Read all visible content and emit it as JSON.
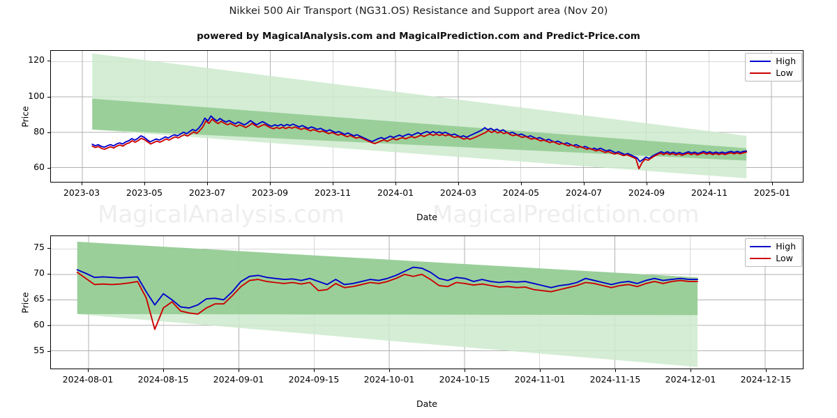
{
  "header": {
    "title": "Nikkei 500 Air Transport (NG31.OS) Resistance and Support area (Nov 20)",
    "subtitle": "powered by MagicalAnalysis.com and MagicalPrediction.com and Predict-Price.com"
  },
  "watermarks": [
    "MagicalAnalysis.com",
    "MagicalPrediction.com"
  ],
  "colors": {
    "high": "#0000cc",
    "low": "#cc0000",
    "band_outer": "#cdeacd",
    "band_inner": "#8fc98f",
    "grid": "#b0b0b0",
    "frame": "#000000"
  },
  "legend": {
    "high_label": "High",
    "low_label": "Low"
  },
  "chart_data": [
    {
      "id": "overview",
      "type": "line",
      "title": "Nikkei 500 Air Transport (NG31.OS) Resistance and Support area (Nov 20)",
      "xlabel": "Date",
      "ylabel": "Price",
      "grid": true,
      "legend_position": "top-right",
      "ylim": [
        52,
        126
      ],
      "yticks": [
        60,
        80,
        100,
        120
      ],
      "xlim": [
        "2023-03-01",
        "2025-01-01"
      ],
      "xticks": [
        "2023-03",
        "2023-05",
        "2023-07",
        "2023-09",
        "2023-11",
        "2024-01",
        "2024-03",
        "2024-05",
        "2024-07",
        "2024-09",
        "2024-11",
        "2025-01"
      ],
      "x_start_frac": 0.055,
      "x_end_frac": 0.925,
      "series": [
        {
          "name": "High",
          "color": "#0000cc",
          "values": [
            73.2,
            72.4,
            73.0,
            72.0,
            71.6,
            72.4,
            73.0,
            72.3,
            73.4,
            74.0,
            73.4,
            74.6,
            75.2,
            76.4,
            75.6,
            76.6,
            78.0,
            77.2,
            75.8,
            74.6,
            75.4,
            76.2,
            75.6,
            76.4,
            77.4,
            76.8,
            77.8,
            78.6,
            78.0,
            79.0,
            80.0,
            79.2,
            80.4,
            81.6,
            80.8,
            82.4,
            84.6,
            88.0,
            86.4,
            89.2,
            87.6,
            86.4,
            87.8,
            86.6,
            85.8,
            86.6,
            85.6,
            84.8,
            85.8,
            85.0,
            84.2,
            85.2,
            86.6,
            85.4,
            84.2,
            85.2,
            86.0,
            85.0,
            84.0,
            83.4,
            84.2,
            83.6,
            84.4,
            83.6,
            84.4,
            83.8,
            84.6,
            83.8,
            83.0,
            83.8,
            83.0,
            82.2,
            83.0,
            82.4,
            81.6,
            82.2,
            81.4,
            80.6,
            81.4,
            80.6,
            79.8,
            80.4,
            79.6,
            78.8,
            79.6,
            78.8,
            78.0,
            78.6,
            77.8,
            77.0,
            76.2,
            75.4,
            74.8,
            75.6,
            76.4,
            77.0,
            76.2,
            77.0,
            77.8,
            77.0,
            77.8,
            78.4,
            77.6,
            78.4,
            79.0,
            78.2,
            79.0,
            79.8,
            79.0,
            79.8,
            80.4,
            79.6,
            80.4,
            79.6,
            80.2,
            79.4,
            80.0,
            79.2,
            78.4,
            79.0,
            78.2,
            77.4,
            78.0,
            77.2,
            78.0,
            78.8,
            79.6,
            80.4,
            81.2,
            82.6,
            81.4,
            82.2,
            81.0,
            81.8,
            80.6,
            81.4,
            80.2,
            79.4,
            80.0,
            79.2,
            78.4,
            79.0,
            78.2,
            77.4,
            78.0,
            77.2,
            76.4,
            77.0,
            76.2,
            75.4,
            76.0,
            75.2,
            74.4,
            75.0,
            74.2,
            73.4,
            74.0,
            73.2,
            72.4,
            73.0,
            72.2,
            71.4,
            72.0,
            71.2,
            70.4,
            71.0,
            70.2,
            71.0,
            70.2,
            69.4,
            70.0,
            69.2,
            68.4,
            69.0,
            68.2,
            67.4,
            68.0,
            67.2,
            66.4,
            65.6,
            63.4,
            64.6,
            66.0,
            65.2,
            66.4,
            67.4,
            68.2,
            69.0,
            68.2,
            69.0,
            68.2,
            68.8,
            68.0,
            68.6,
            67.8,
            68.4,
            69.0,
            68.2,
            68.8,
            68.0,
            68.6,
            69.2,
            68.4,
            69.0,
            68.2,
            68.8,
            68.2,
            68.8,
            68.2,
            68.8,
            69.2,
            68.6,
            69.2,
            68.6,
            69.2,
            69.4
          ]
        },
        {
          "name": "Low",
          "color": "#cc0000",
          "values": [
            72.2,
            71.4,
            72.0,
            70.9,
            70.4,
            71.2,
            71.8,
            71.1,
            72.2,
            72.8,
            72.2,
            73.4,
            74.0,
            75.2,
            74.4,
            75.4,
            76.6,
            75.8,
            74.6,
            73.4,
            74.2,
            75.0,
            74.4,
            75.2,
            76.2,
            75.6,
            76.6,
            77.4,
            76.8,
            77.8,
            78.6,
            77.9,
            79.0,
            80.2,
            79.4,
            81.0,
            83.0,
            86.4,
            85.0,
            87.4,
            86.0,
            84.9,
            86.2,
            85.1,
            84.3,
            85.0,
            84.1,
            83.3,
            84.2,
            83.5,
            82.7,
            83.7,
            85.0,
            83.9,
            82.8,
            83.7,
            84.4,
            83.5,
            82.6,
            82.0,
            82.7,
            82.1,
            82.9,
            82.1,
            82.9,
            82.3,
            83.0,
            82.3,
            81.6,
            82.3,
            81.6,
            80.8,
            81.5,
            80.9,
            80.2,
            80.7,
            80.0,
            79.2,
            79.9,
            79.2,
            78.4,
            79.0,
            78.2,
            77.5,
            78.2,
            77.4,
            76.7,
            77.2,
            76.5,
            75.7,
            74.9,
            74.2,
            73.6,
            74.3,
            75.1,
            75.7,
            74.9,
            75.7,
            76.5,
            75.7,
            76.4,
            77.0,
            76.3,
            77.0,
            77.6,
            76.9,
            77.6,
            78.4,
            77.6,
            78.4,
            79.0,
            78.2,
            79.0,
            78.2,
            78.8,
            78.0,
            78.6,
            77.8,
            77.1,
            77.6,
            76.9,
            76.1,
            76.7,
            76.0,
            76.7,
            77.4,
            78.2,
            79.0,
            79.8,
            81.0,
            79.9,
            80.7,
            79.6,
            80.3,
            79.2,
            79.9,
            78.8,
            78.1,
            78.6,
            77.9,
            77.1,
            77.6,
            76.9,
            76.1,
            76.6,
            75.9,
            75.1,
            75.6,
            74.9,
            74.2,
            74.7,
            74.0,
            73.2,
            73.7,
            73.0,
            72.3,
            72.8,
            72.1,
            71.4,
            71.9,
            71.2,
            70.4,
            70.9,
            70.2,
            69.5,
            70.0,
            69.3,
            68.6,
            69.1,
            68.4,
            67.7,
            68.2,
            67.5,
            66.8,
            67.3,
            66.6,
            65.9,
            65.1,
            59.4,
            62.8,
            64.8,
            64.2,
            65.4,
            66.5,
            67.4,
            68.2,
            67.4,
            68.2,
            67.4,
            68.0,
            67.2,
            67.8,
            67.0,
            67.6,
            68.2,
            67.4,
            68.0,
            67.2,
            67.8,
            68.4,
            67.6,
            68.2,
            67.4,
            68.0,
            67.4,
            68.0,
            67.4,
            68.0,
            68.4,
            67.8,
            68.4,
            67.8,
            68.4,
            68.8
          ]
        }
      ],
      "bands": [
        {
          "name": "outer",
          "color": "#cdeacd",
          "left_top": 124.5,
          "left_bottom": 81.5,
          "right_top": 78.0,
          "right_bottom": 54.0,
          "x_start_frac": 0.055,
          "x_end_frac": 0.925
        },
        {
          "name": "inner",
          "color": "#8fc98f",
          "left_top": 99.0,
          "left_bottom": 81.5,
          "right_top": 71.0,
          "right_bottom": 64.0,
          "x_start_frac": 0.055,
          "x_end_frac": 0.925
        }
      ]
    },
    {
      "id": "recent",
      "type": "line",
      "xlabel": "Date",
      "ylabel": "Price",
      "grid": true,
      "legend_position": "top-right",
      "ylim": [
        51.5,
        77.5
      ],
      "yticks": [
        55,
        60,
        65,
        70,
        75
      ],
      "xlim": [
        "2024-07-22",
        "2024-12-15"
      ],
      "xticks": [
        "2024-08-01",
        "2024-08-15",
        "2024-09-01",
        "2024-09-15",
        "2024-10-01",
        "2024-10-15",
        "2024-11-01",
        "2024-11-15",
        "2024-12-01",
        "2024-12-15"
      ],
      "x_start_frac": 0.035,
      "x_end_frac": 0.86,
      "series": [
        {
          "name": "High",
          "color": "#0000cc",
          "values": [
            70.9,
            70.2,
            69.4,
            69.5,
            69.4,
            69.3,
            69.4,
            69.5,
            66.6,
            64.0,
            66.2,
            65.0,
            63.6,
            63.4,
            64.0,
            65.2,
            65.3,
            65.0,
            66.6,
            68.6,
            69.6,
            69.8,
            69.4,
            69.2,
            69.0,
            69.1,
            68.8,
            69.2,
            68.6,
            68.0,
            69.0,
            68.0,
            68.2,
            68.6,
            69.0,
            68.8,
            69.2,
            69.8,
            70.6,
            71.4,
            71.2,
            70.4,
            69.2,
            68.8,
            69.4,
            69.2,
            68.6,
            69.0,
            68.6,
            68.4,
            68.6,
            68.5,
            68.6,
            68.2,
            67.8,
            67.4,
            67.8,
            68.0,
            68.4,
            69.2,
            68.8,
            68.4,
            68.0,
            68.4,
            68.6,
            68.2,
            68.8,
            69.2,
            68.8,
            69.0,
            69.2,
            69.0,
            69.0
          ]
        },
        {
          "name": "Low",
          "color": "#cc0000",
          "values": [
            70.4,
            69.2,
            68.0,
            68.1,
            68.0,
            68.1,
            68.3,
            68.6,
            65.4,
            59.2,
            63.4,
            64.6,
            62.8,
            62.4,
            62.2,
            63.4,
            64.2,
            64.2,
            65.8,
            67.6,
            68.8,
            69.0,
            68.6,
            68.4,
            68.2,
            68.4,
            68.1,
            68.4,
            66.8,
            67.0,
            68.2,
            67.4,
            67.6,
            68.0,
            68.4,
            68.2,
            68.6,
            69.2,
            70.0,
            69.6,
            70.0,
            69.0,
            67.8,
            67.6,
            68.4,
            68.2,
            67.9,
            68.1,
            67.8,
            67.5,
            67.6,
            67.4,
            67.5,
            67.0,
            66.8,
            66.6,
            67.0,
            67.4,
            67.8,
            68.4,
            68.2,
            67.8,
            67.4,
            67.8,
            68.0,
            67.6,
            68.2,
            68.6,
            68.2,
            68.6,
            68.8,
            68.6,
            68.6
          ]
        }
      ],
      "bands": [
        {
          "name": "outer",
          "color": "#cdeacd",
          "left_top": 76.4,
          "left_bottom": 62.2,
          "right_top": 69.4,
          "right_bottom": 51.8,
          "x_start_frac": 0.035,
          "x_end_frac": 0.86
        },
        {
          "name": "inner",
          "color": "#8fc98f",
          "left_top": 76.4,
          "left_bottom": 62.2,
          "right_top": 69.4,
          "right_bottom": 62.0,
          "x_start_frac": 0.035,
          "x_end_frac": 0.86
        }
      ]
    }
  ]
}
